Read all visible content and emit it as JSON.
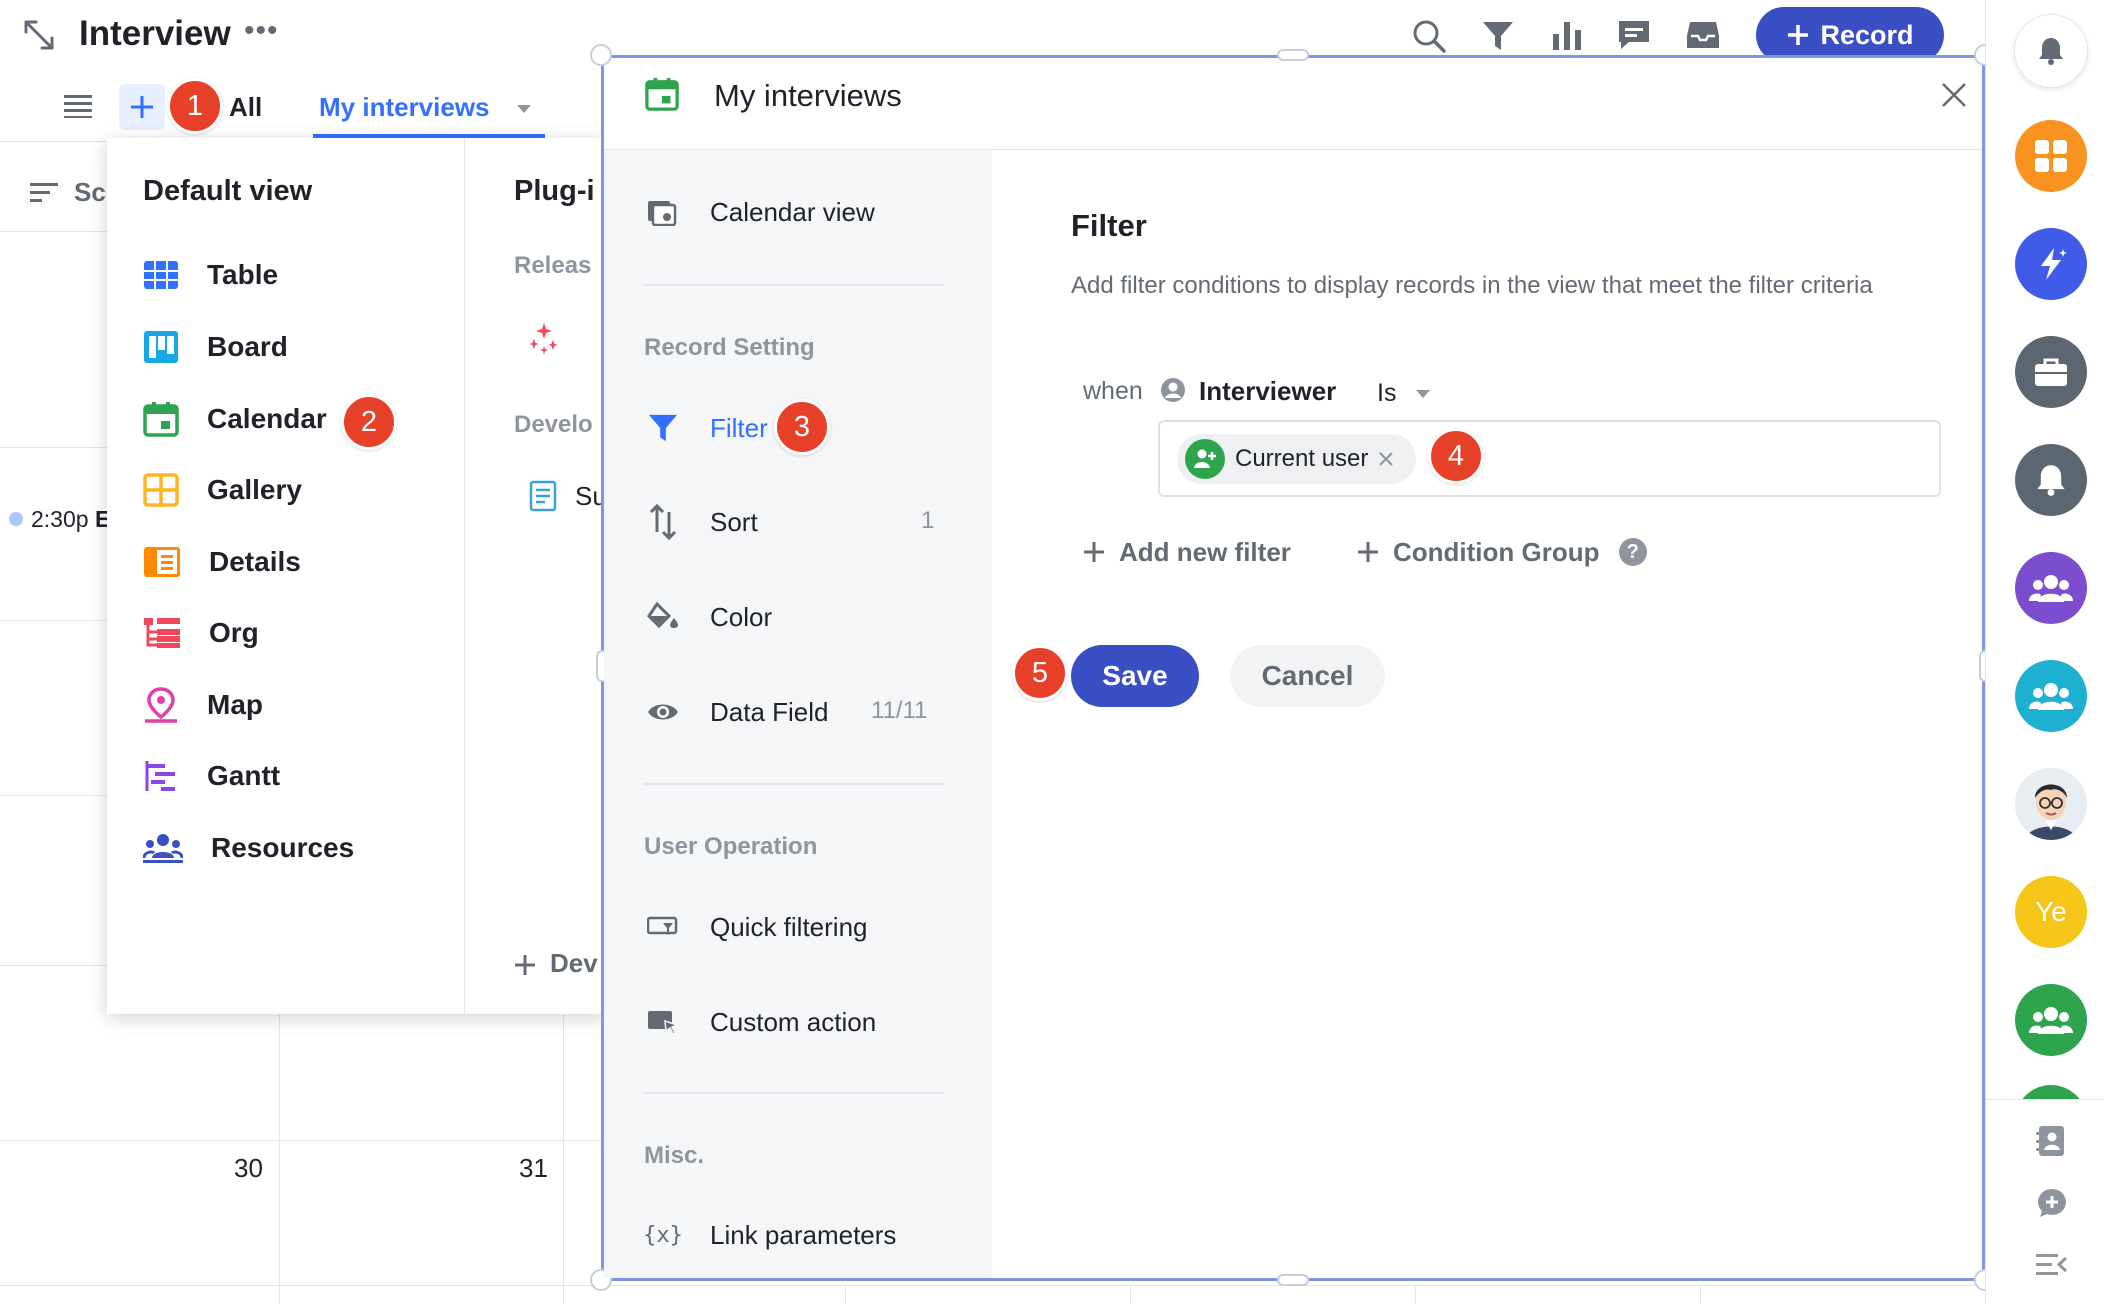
{
  "header": {
    "title": "Interview",
    "tabs": {
      "all": "All",
      "my_interviews": "My interviews"
    },
    "record_button": "Record"
  },
  "calendar": {
    "event_time": "2:30p",
    "event_initial": "E",
    "day_30": "30",
    "day_31": "31",
    "toolbar_partial": "Sc"
  },
  "view_menu": {
    "default_view_title": "Default view",
    "items": [
      {
        "label": "Table",
        "icon": "table-icon",
        "color": "#3370ff"
      },
      {
        "label": "Board",
        "icon": "board-icon",
        "color": "#14a9e3"
      },
      {
        "label": "Calendar",
        "icon": "calendar-icon",
        "color": "#2ea44f"
      },
      {
        "label": "Gallery",
        "icon": "gallery-icon",
        "color": "#ffb320"
      },
      {
        "label": "Details",
        "icon": "details-icon",
        "color": "#ff8a00"
      },
      {
        "label": "Org",
        "icon": "org-icon",
        "color": "#f0475b"
      },
      {
        "label": "Map",
        "icon": "map-pin-icon",
        "color": "#e23fa7"
      },
      {
        "label": "Gantt",
        "icon": "gantt-icon",
        "color": "#8e44ec"
      },
      {
        "label": "Resources",
        "icon": "resources-icon",
        "color": "#3b4fc4"
      }
    ],
    "plugin_title": "Plug-i",
    "release_label": "Releas",
    "develop_label": "Develo",
    "develop_item": "Su",
    "develop_add": "Dev"
  },
  "dialog": {
    "title": "My interviews",
    "settings": {
      "calendar_view": "Calendar view",
      "record_setting_section": "Record Setting",
      "filter": "Filter",
      "sort": "Sort",
      "sort_count": "1",
      "color": "Color",
      "data_field": "Data Field",
      "data_field_count": "11/11",
      "user_operation_section": "User Operation",
      "quick_filtering": "Quick filtering",
      "custom_action": "Custom action",
      "misc_section": "Misc.",
      "link_parameters": "Link parameters"
    },
    "filter": {
      "title": "Filter",
      "description": "Add filter conditions to display records in the view that meet the filter criteria",
      "when": "when",
      "field": "Interviewer",
      "operator": "Is",
      "value_chip": "Current user",
      "add_new_filter": "Add new filter",
      "condition_group": "Condition Group"
    },
    "save": "Save",
    "cancel": "Cancel"
  },
  "badges": [
    "1",
    "2",
    "3",
    "4",
    "5"
  ],
  "right_rail": {
    "avatar_initials": "Ye",
    "colors": [
      "#f7931e",
      "#3f5be8",
      "#5c6670",
      "#5c6670",
      "#7c4dcf",
      "#1eb0d0",
      "#f5c518",
      "#2ea44f"
    ]
  }
}
